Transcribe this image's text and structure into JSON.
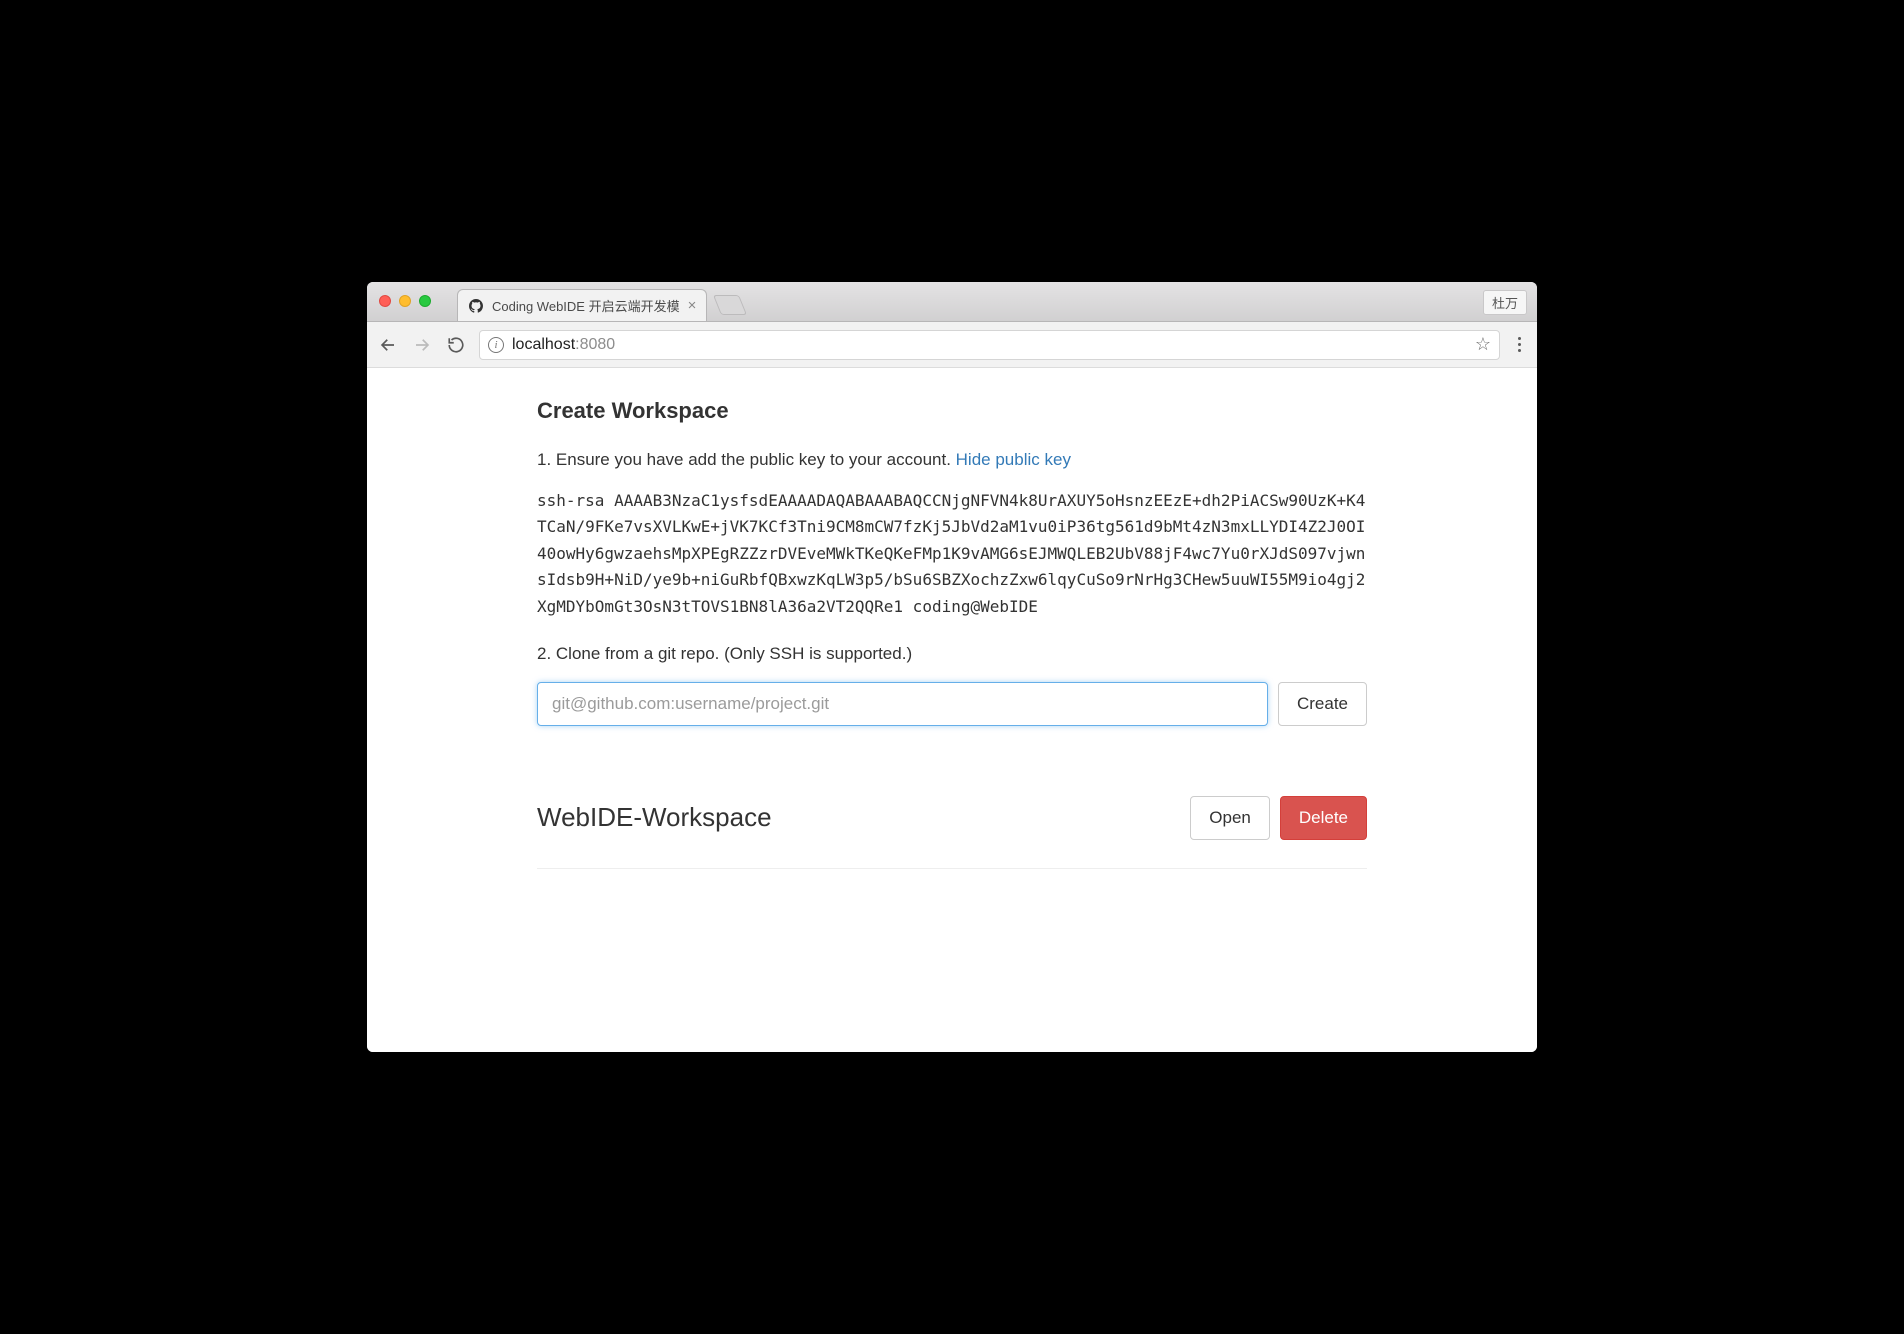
{
  "browser": {
    "tab_title": "Coding WebIDE 开启云端开发模",
    "profile_name": "杜万",
    "url_host": "localhost",
    "url_port": ":8080"
  },
  "page": {
    "heading": "Create Workspace",
    "step1_prefix": "1. Ensure you have add the public key to your account. ",
    "hide_key_link": "Hide public key",
    "ssh_key": "ssh-rsa AAAAB3NzaC1ysfsdEAAAADAQABAAABAQCCNjgNFVN4k8UrAXUY5oHsnzEEzE+dh2PiACSw90UzK+K4TCaN/9FKe7vsXVLKwE+jVK7KCf3Tni9CM8mCW7fzKj5JbVd2aM1vu0iP36tg561d9bMt4zN3mxLLYDI4Z2J0OI40owHy6gwzaehsMpXPEgRZZzrDVEveMWkTKeQKeFMp1K9vAMG6sEJMWQLEB2UbV88jF4wc7Yu0rXJdS097vjwnsIdsb9H+NiD/ye9b+niGuRbfQBxwzKqLW3p5/bSu6SBZXochzZxw6lqyCuSo9rNrHg3CHew5uuWI55M9io4gj2XgMDYbOmGt3OsN3tTOVS1BN8lA36a2VT2QQRe1 coding@WebIDE",
    "step2_text": "2. Clone from a git repo. (Only SSH is supported.)",
    "git_placeholder": "git@github.com:username/project.git",
    "create_label": "Create"
  },
  "workspaces": [
    {
      "name": "WebIDE-Workspace",
      "open_label": "Open",
      "delete_label": "Delete"
    }
  ]
}
